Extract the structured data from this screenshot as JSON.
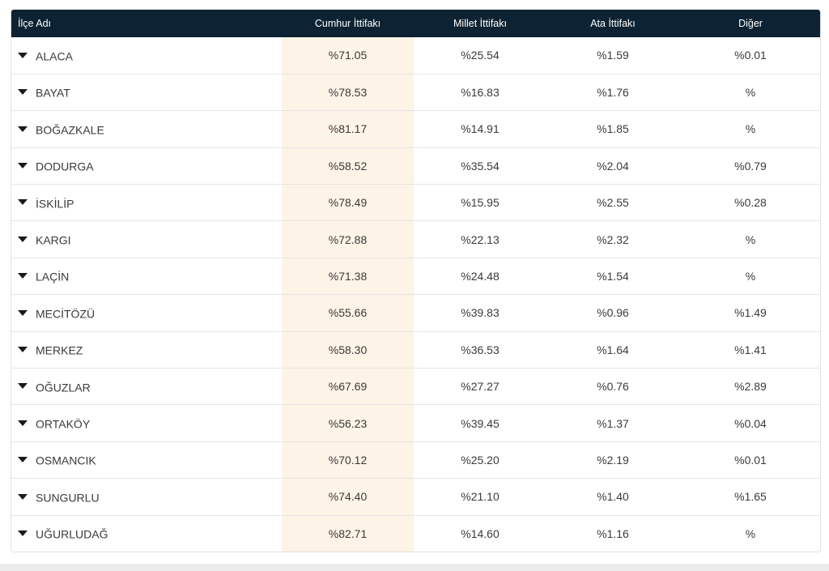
{
  "header": {
    "district": "İlçe Adı",
    "cumhur": "Cumhur İttifakı",
    "millet": "Millet İttifakı",
    "ata": "Ata İttifakı",
    "diger": "Diğer"
  },
  "rows": [
    {
      "name": "ALACA",
      "cumhur": "%71.05",
      "millet": "%25.54",
      "ata": "%1.59",
      "diger": "%0.01"
    },
    {
      "name": "BAYAT",
      "cumhur": "%78.53",
      "millet": "%16.83",
      "ata": "%1.76",
      "diger": "%"
    },
    {
      "name": "BOĞAZKALE",
      "cumhur": "%81.17",
      "millet": "%14.91",
      "ata": "%1.85",
      "diger": "%"
    },
    {
      "name": "DODURGA",
      "cumhur": "%58.52",
      "millet": "%35.54",
      "ata": "%2.04",
      "diger": "%0.79"
    },
    {
      "name": "İSKİLİP",
      "cumhur": "%78.49",
      "millet": "%15.95",
      "ata": "%2.55",
      "diger": "%0.28"
    },
    {
      "name": "KARGI",
      "cumhur": "%72.88",
      "millet": "%22.13",
      "ata": "%2.32",
      "diger": "%"
    },
    {
      "name": "LAÇİN",
      "cumhur": "%71.38",
      "millet": "%24.48",
      "ata": "%1.54",
      "diger": "%"
    },
    {
      "name": "MECİTÖZÜ",
      "cumhur": "%55.66",
      "millet": "%39.83",
      "ata": "%0.96",
      "diger": "%1.49"
    },
    {
      "name": "MERKEZ",
      "cumhur": "%58.30",
      "millet": "%36.53",
      "ata": "%1.64",
      "diger": "%1.41"
    },
    {
      "name": "OĞUZLAR",
      "cumhur": "%67.69",
      "millet": "%27.27",
      "ata": "%0.76",
      "diger": "%2.89"
    },
    {
      "name": "ORTAKÖY",
      "cumhur": "%56.23",
      "millet": "%39.45",
      "ata": "%1.37",
      "diger": "%0.04"
    },
    {
      "name": "OSMANCIK",
      "cumhur": "%70.12",
      "millet": "%25.20",
      "ata": "%2.19",
      "diger": "%0.01"
    },
    {
      "name": "SUNGURLU",
      "cumhur": "%74.40",
      "millet": "%21.10",
      "ata": "%1.40",
      "diger": "%1.65"
    },
    {
      "name": "UĞURLUDAĞ",
      "cumhur": "%82.71",
      "millet": "%14.60",
      "ata": "%1.16",
      "diger": "%"
    }
  ],
  "colors": {
    "header_bg": "#0d2232",
    "highlight_column": "#fdf3e6"
  },
  "icons": {
    "row_toggle": "caret-down-icon"
  }
}
